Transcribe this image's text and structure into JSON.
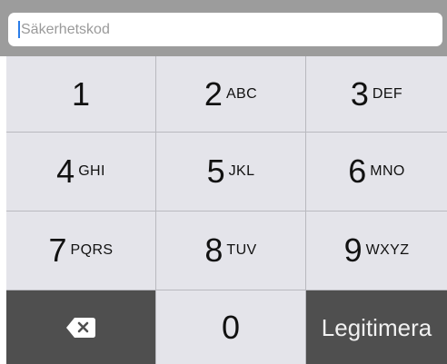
{
  "code_input": {
    "placeholder": "Säkerhetskod",
    "value": ""
  },
  "keys": [
    {
      "number": "1",
      "letters": ""
    },
    {
      "number": "2",
      "letters": "ABC"
    },
    {
      "number": "3",
      "letters": "DEF"
    },
    {
      "number": "4",
      "letters": "GHI"
    },
    {
      "number": "5",
      "letters": "JKL"
    },
    {
      "number": "6",
      "letters": "MNO"
    },
    {
      "number": "7",
      "letters": "PQRS"
    },
    {
      "number": "8",
      "letters": "TUV"
    },
    {
      "number": "9",
      "letters": "WXYZ"
    },
    {
      "number": "0",
      "letters": ""
    }
  ],
  "actions": {
    "delete_icon": "backspace-icon",
    "confirm_label": "Legitimera"
  },
  "colors": {
    "header_bar": "#9c9c9c",
    "key_background": "#e4e4ea",
    "dark_key_background": "#4f4f4f",
    "caret": "#2b7de9"
  }
}
